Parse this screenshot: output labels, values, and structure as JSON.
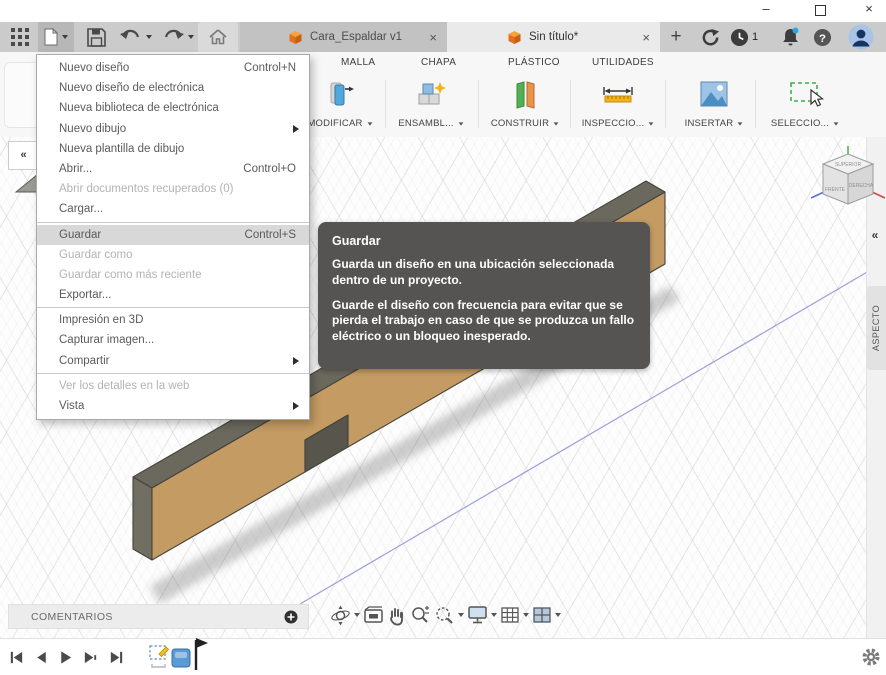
{
  "app_tabs": {
    "items": [
      {
        "label": "Cara_Espaldar v1"
      },
      {
        "label": "Sin título*"
      }
    ],
    "new_tab": "+"
  },
  "notifications": {
    "clock_count": "1"
  },
  "ribbon": {
    "tabs": [
      "MALLA",
      "CHAPA",
      "PLÁSTICO",
      "UTILIDADES"
    ],
    "groups": [
      {
        "label": "MODIFICAR"
      },
      {
        "label": "ENSAMBL..."
      },
      {
        "label": "CONSTRUIR"
      },
      {
        "label": "INSPECCIO..."
      },
      {
        "label": "INSERTAR"
      },
      {
        "label": "SELECCIO..."
      }
    ]
  },
  "file_menu": {
    "items": [
      {
        "label": "Nuevo diseño",
        "shortcut": "Control+N"
      },
      {
        "label": "Nuevo diseño de electrónica"
      },
      {
        "label": "Nueva biblioteca de electrónica"
      },
      {
        "label": "Nuevo dibujo"
      },
      {
        "label": "Nueva plantilla de dibujo"
      },
      {
        "label": "Abrir...",
        "shortcut": "Control+O"
      },
      {
        "label": "Abrir documentos recuperados (0)"
      },
      {
        "label": "Cargar..."
      },
      {
        "label": "Guardar",
        "shortcut": "Control+S"
      },
      {
        "label": "Guardar como"
      },
      {
        "label": "Guardar como más reciente"
      },
      {
        "label": "Exportar..."
      },
      {
        "label": "Impresión en 3D"
      },
      {
        "label": "Capturar imagen..."
      },
      {
        "label": "Compartir"
      },
      {
        "label": "Ver los detalles en la web"
      },
      {
        "label": "Vista"
      }
    ]
  },
  "tooltip": {
    "title": "Guardar",
    "p1": "Guarda un diseño en una ubicación seleccionada dentro de un proyecto.",
    "p2": "Guarde el diseño con frecuencia para evitar que se pierda el trabajo en caso de que se produzca un fallo eléctrico o un bloqueo inesperado."
  },
  "canvas_ui": {
    "comments_label": "COMENTARIOS",
    "aspect_label": "ASPECTO",
    "viewcube": {
      "top": "SUPERIOR",
      "front": "FRENTE",
      "right": "DERECHA"
    }
  }
}
